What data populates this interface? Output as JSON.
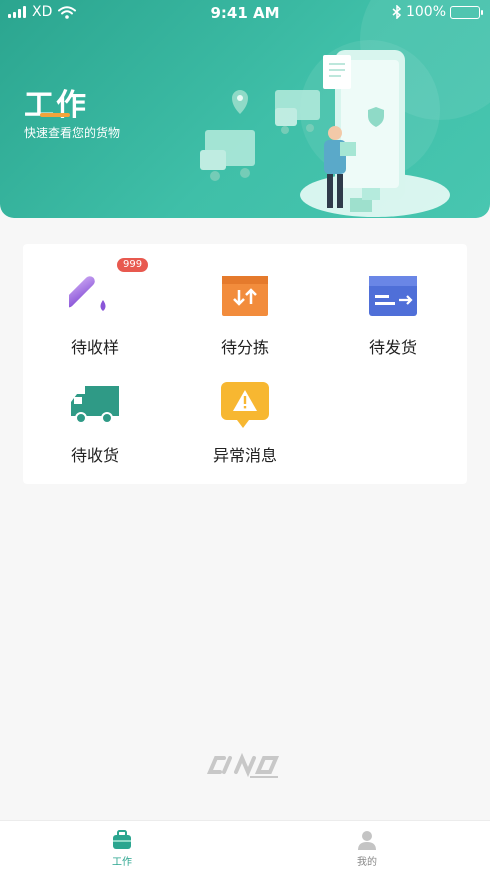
{
  "status_bar": {
    "carrier": "XD",
    "time": "9:41 AM",
    "battery": "100%",
    "battery_level": 1.0
  },
  "header": {
    "title": "工作",
    "subtitle": "快速查看您的货物"
  },
  "grid": {
    "items": [
      {
        "label": "待收样",
        "icon": "test-tube-icon",
        "badge": "999"
      },
      {
        "label": "待分拣",
        "icon": "sort-box-icon"
      },
      {
        "label": "待发货",
        "icon": "shipping-card-icon"
      },
      {
        "label": "待收货",
        "icon": "truck-icon"
      },
      {
        "label": "异常消息",
        "icon": "warning-bubble-icon"
      }
    ]
  },
  "footer_logo": {
    "icon": "cino-logo"
  },
  "tabbar": {
    "tabs": [
      {
        "label": "工作",
        "icon": "briefcase-icon",
        "active": true
      },
      {
        "label": "我的",
        "icon": "person-icon",
        "active": false
      }
    ]
  },
  "colors": {
    "brand": "#2ba58f",
    "badge": "#e8594f",
    "accent_orange": "#f2a43b"
  }
}
